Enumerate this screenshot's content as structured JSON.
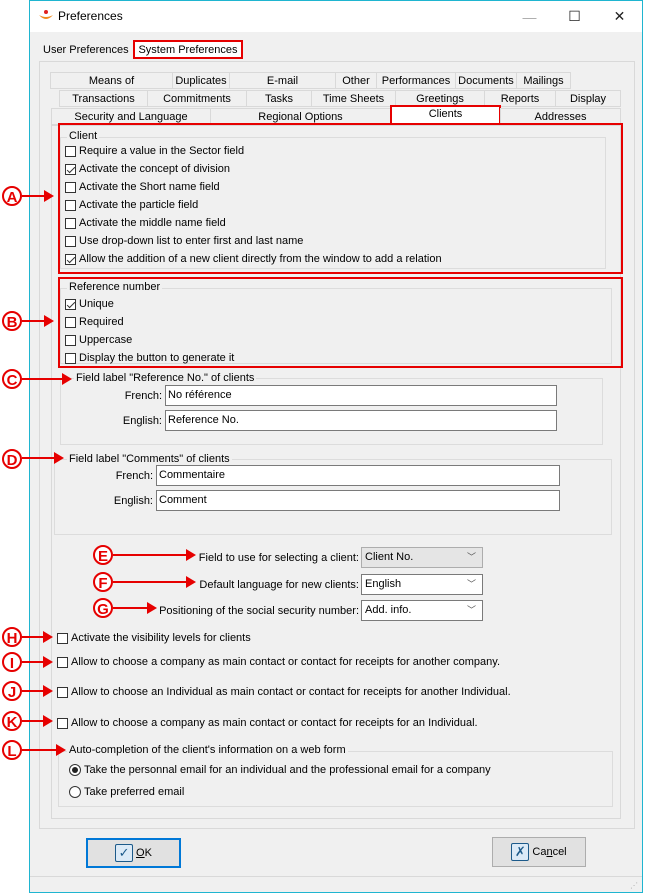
{
  "window": {
    "title": "Preferences",
    "icon": "app-logo-icon",
    "minimize": "—",
    "maximize": "☐",
    "close": "✕"
  },
  "outer_tabs": [
    {
      "label": "User Preferences",
      "active": false
    },
    {
      "label": "System Preferences",
      "active": true
    }
  ],
  "inner_tabs": {
    "row1": [
      "Means of communication",
      "Duplicates",
      "E-mail Blast/eReceipts",
      "Other",
      "Performances",
      "Documents",
      "Mailings"
    ],
    "row2": [
      "Transactions",
      "Commitments",
      "Tasks",
      "Time Sheets",
      "Greetings",
      "Reports",
      "Display"
    ],
    "row3": [
      "Security and Language",
      "Regional Options",
      "Clients",
      "Addresses"
    ],
    "active": "Clients"
  },
  "client_group": {
    "label": "Client",
    "items": [
      {
        "label": "Require a value in the Sector field",
        "checked": false
      },
      {
        "label": "Activate the concept of division",
        "checked": true
      },
      {
        "label": "Activate the Short name field",
        "checked": false
      },
      {
        "label": "Activate the particle field",
        "checked": false
      },
      {
        "label": "Activate the middle name field",
        "checked": false
      },
      {
        "label": "Use drop-down list to enter first and last name",
        "checked": false
      },
      {
        "label": "Allow the addition of a new client directly from the window to add a relation",
        "checked": true
      }
    ]
  },
  "reference_group": {
    "label": "Reference number",
    "items": [
      {
        "label": "Unique",
        "checked": true
      },
      {
        "label": "Required",
        "checked": false
      },
      {
        "label": "Uppercase",
        "checked": false
      },
      {
        "label": "Display the button to generate it",
        "checked": false
      }
    ]
  },
  "ref_label_group": {
    "label": "Field label \"Reference No.\" of clients",
    "french_label": "French:",
    "french_value": "No référence",
    "english_label": "English:",
    "english_value": "Reference No."
  },
  "comments_label_group": {
    "label": "Field label \"Comments\" of clients",
    "french_label": "French:",
    "french_value": "Commentaire",
    "english_label": "English:",
    "english_value": "Comment"
  },
  "selects": [
    {
      "label": "Field to use for selecting a client:",
      "value": "Client No."
    },
    {
      "label": "Default language for new clients:",
      "value": "English"
    },
    {
      "label": "Positioning of the social security number:",
      "value": "Add. info."
    }
  ],
  "options": [
    {
      "label": "Activate the visibility levels for clients",
      "checked": false
    },
    {
      "label": "Allow to choose a company as main contact or contact for receipts for another company.",
      "checked": false
    },
    {
      "label": "Allow to choose an Individual as main contact or contact for receipts for another Individual.",
      "checked": false
    },
    {
      "label": "Allow to choose a company as main contact or contact for receipts for an Individual.",
      "checked": false
    }
  ],
  "autocomplete_group": {
    "label": "Auto-completion of the client's information on a web form",
    "options": [
      {
        "label": "Take the personnal email for an individual and the professional email for a company",
        "selected": true
      },
      {
        "label": "Take preferred email",
        "selected": false
      }
    ]
  },
  "buttons": {
    "ok": {
      "prefix": "",
      "accel": "O",
      "suffix": "K"
    },
    "cancel": {
      "prefix": "Ca",
      "accel": "n",
      "suffix": "cel"
    }
  },
  "markers": [
    "A",
    "B",
    "C",
    "D",
    "E",
    "F",
    "G",
    "H",
    "I",
    "J",
    "K",
    "L"
  ],
  "annotation_color": "#e60000",
  "accent_color": "#0078d7"
}
